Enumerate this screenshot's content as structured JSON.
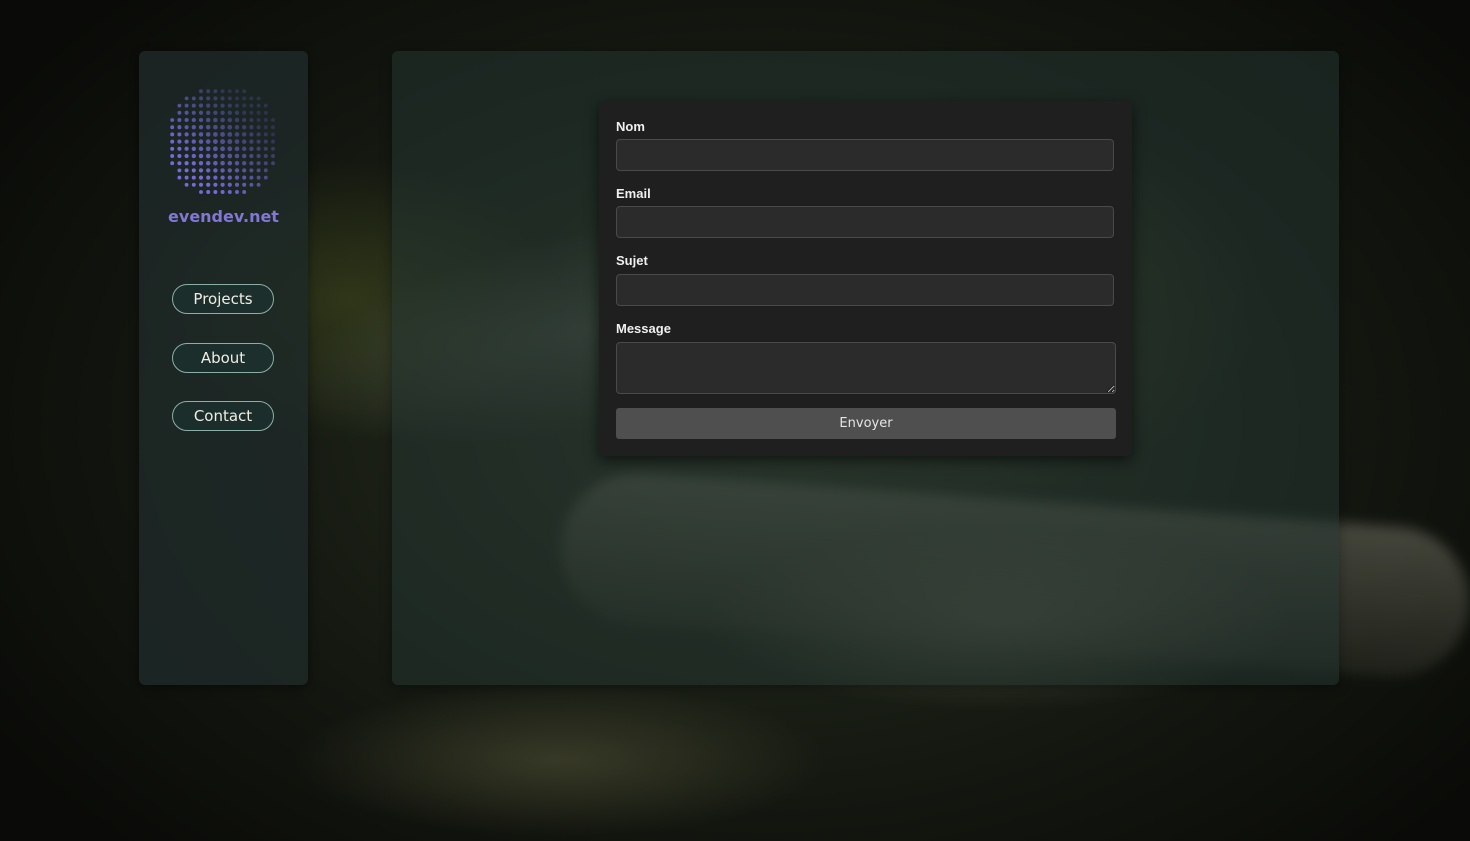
{
  "sidebar": {
    "brand": "evendev.net",
    "nav": [
      {
        "label": "Projects"
      },
      {
        "label": "About"
      },
      {
        "label": "Contact"
      }
    ]
  },
  "contact_form": {
    "fields": [
      {
        "label": "Nom",
        "value": ""
      },
      {
        "label": "Email",
        "value": ""
      },
      {
        "label": "Sujet",
        "value": ""
      },
      {
        "label": "Message",
        "value": ""
      }
    ],
    "submit_label": "Envoyer"
  },
  "colors": {
    "brand": "#8377d6",
    "nav_border": "#8ab0a6",
    "card_bg": "#1f1f1f",
    "input_bg": "#2b2b2b",
    "button_bg": "#4f4f4f"
  }
}
